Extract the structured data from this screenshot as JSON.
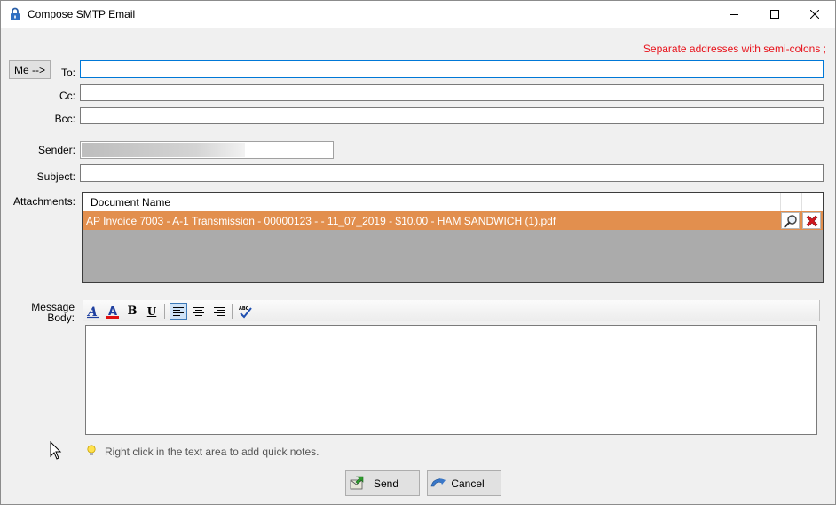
{
  "window": {
    "title": "Compose SMTP Email",
    "icons": {
      "app": "lock-icon",
      "minimize": "minimize-icon",
      "maximize": "maximize-icon",
      "close": "close-icon"
    }
  },
  "hint": "Separate addresses with semi-colons ;",
  "me_button": "Me -->",
  "fields": {
    "to": {
      "label": "To:",
      "value": ""
    },
    "cc": {
      "label": "Cc:",
      "value": ""
    },
    "bcc": {
      "label": "Bcc:",
      "value": ""
    },
    "sender": {
      "label": "Sender:",
      "value": ""
    },
    "subject": {
      "label": "Subject:",
      "value": ""
    }
  },
  "attachments": {
    "label": "Attachments:",
    "column": "Document Name",
    "rows": [
      {
        "name": "AP Invoice 7003 - A-1 Transmission - 00000123 -  - 11_07_2019 - $10.00 - HAM SANDWICH (1).pdf"
      }
    ],
    "row_icons": [
      "magnifier-icon",
      "delete-x-icon"
    ],
    "colors": {
      "row": "#e28f4e",
      "empty": "#ababab"
    }
  },
  "message": {
    "label_line1": "Message",
    "label_line2": "Body:",
    "toolbar": [
      "font-icon",
      "font-color-icon",
      "bold-icon",
      "underline-icon",
      "align-left-icon",
      "align-center-icon",
      "align-right-icon",
      "spellcheck-icon"
    ],
    "bold": "B",
    "underline": "U",
    "font_glyph": "A",
    "spell_text": "ABC",
    "body": ""
  },
  "note": "Right click in the text area to add quick notes.",
  "buttons": {
    "send": "Send",
    "cancel": "Cancel"
  },
  "colors": {
    "hint": "#e8111a",
    "accent": "#0078d7"
  }
}
